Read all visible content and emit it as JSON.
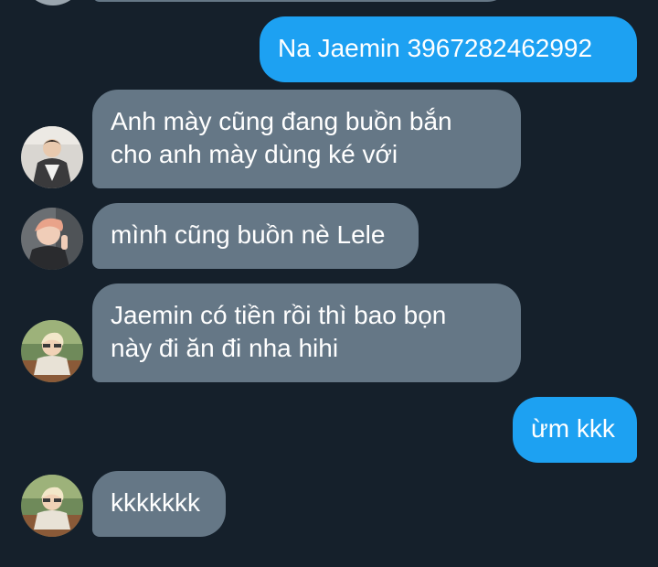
{
  "messages": [
    {
      "id": "m0",
      "direction": "incoming",
      "lines": [
        ""
      ],
      "partial": true
    },
    {
      "id": "m1",
      "direction": "outgoing",
      "lines": [
        "Na Jaemin 3967282462992"
      ]
    },
    {
      "id": "m2",
      "direction": "incoming",
      "avatar": "user-avatar-1",
      "lines": [
        "Anh mày cũng đang buồn bắn",
        "cho anh mày dùng ké với"
      ]
    },
    {
      "id": "m3",
      "direction": "incoming",
      "avatar": "user-avatar-2",
      "lines": [
        "mình cũng buồn nè Lele"
      ]
    },
    {
      "id": "m4",
      "direction": "incoming",
      "avatar": "user-avatar-3",
      "lines": [
        "Jaemin có tiền rồi thì bao bọn",
        "này đi ăn đi nha hihi"
      ]
    },
    {
      "id": "m5",
      "direction": "outgoing",
      "lines": [
        "ừm kkk"
      ]
    },
    {
      "id": "m6",
      "direction": "incoming",
      "avatar": "user-avatar-3",
      "lines": [
        "kkkkkkk"
      ]
    }
  ],
  "colors": {
    "background": "#15202b",
    "incoming_bubble": "#657786",
    "outgoing_bubble": "#1da1f2",
    "text": "#ffffff"
  }
}
